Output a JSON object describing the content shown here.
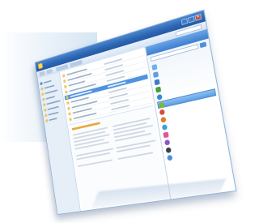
{
  "window": {
    "title": "",
    "close_glyph": "✕"
  },
  "colors": {
    "titlebar": "#2c65b2",
    "selection": "#4f93de",
    "folder": "#e9c75b",
    "side_header": "#3d7fcf"
  },
  "nav": {
    "items": [
      {
        "icon": "home-icon",
        "color": "#4f8fd8"
      },
      {
        "icon": "folder-icon",
        "color": "#e9c75b"
      },
      {
        "icon": "folder-icon",
        "color": "#e9c75b"
      },
      {
        "icon": "folder-icon",
        "color": "#e9c75b"
      },
      {
        "icon": "folder-icon",
        "color": "#e9c75b"
      },
      {
        "icon": "folder-icon",
        "color": "#e9c75b"
      },
      {
        "icon": "folder-icon",
        "color": "#e9c75b"
      },
      {
        "icon": "folder-icon",
        "color": "#e9c75b"
      }
    ]
  },
  "main": {
    "rows": [
      {
        "selected": false
      },
      {
        "selected": false
      },
      {
        "selected": false
      },
      {
        "selected": false
      },
      {
        "selected": true
      },
      {
        "selected": false
      },
      {
        "selected": false
      },
      {
        "selected": false
      },
      {
        "selected": false
      }
    ]
  },
  "side": {
    "items": [
      {
        "label": "",
        "icon": "user-icon",
        "color": "#6fb0ea",
        "selected": false
      },
      {
        "label": "",
        "icon": "user-icon",
        "color": "#5e9edd",
        "selected": false
      },
      {
        "label": "",
        "icon": "monitor-icon",
        "color": "#3f7bc8",
        "selected": false
      },
      {
        "label": "",
        "icon": "chart-icon",
        "color": "#4d9a3f",
        "selected": false
      },
      {
        "label": "",
        "icon": "globe-icon",
        "color": "#2f8ad8",
        "selected": false
      },
      {
        "label": "",
        "icon": "grid-icon",
        "color": "#7ab640",
        "selected": true
      },
      {
        "label": "",
        "icon": "circle-icon",
        "color": "#d44b3b",
        "selected": false
      },
      {
        "label": "",
        "icon": "globe-icon",
        "color": "#e07a2a",
        "selected": false
      },
      {
        "label": "",
        "icon": "circle-icon",
        "color": "#3aa0e0",
        "selected": false
      },
      {
        "label": "",
        "icon": "heart-icon",
        "color": "#e0559a",
        "selected": false
      },
      {
        "label": "",
        "icon": "circle-icon",
        "color": "#8a55c9",
        "selected": false
      },
      {
        "label": "",
        "icon": "circle-icon",
        "color": "#3b3f48",
        "selected": false
      },
      {
        "label": "",
        "icon": "circle-icon",
        "color": "#4a90d9",
        "selected": false
      }
    ]
  }
}
